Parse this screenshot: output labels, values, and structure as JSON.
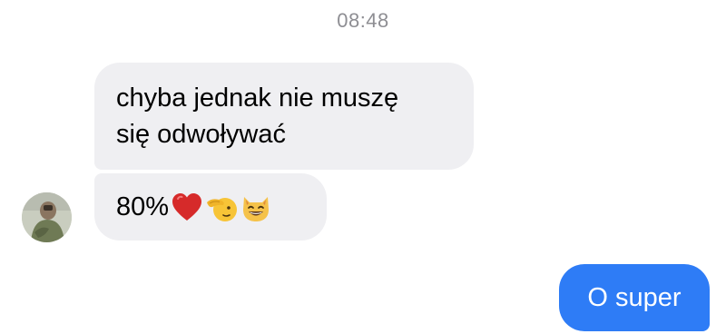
{
  "conversation": {
    "timestamp": "08:48",
    "messages": [
      {
        "direction": "incoming",
        "text": "chyba jednak nie muszę\nsię odwoływać"
      },
      {
        "direction": "incoming",
        "text": "80%",
        "emojis": [
          "red-heart",
          "saluting-face",
          "grinning-cat-with-smiling-eyes"
        ]
      },
      {
        "direction": "outgoing",
        "text": "O super"
      }
    ]
  },
  "colors": {
    "incoming_bubble": "#efeff2",
    "outgoing_bubble": "#2e7cf6",
    "timestamp": "#8e8e93"
  }
}
